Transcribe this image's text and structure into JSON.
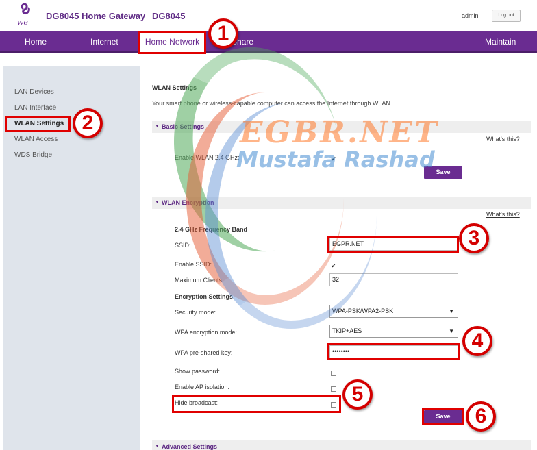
{
  "header": {
    "logo_text": "we",
    "brand": "DG8045 Home Gateway",
    "model": "DG8045",
    "user": "admin",
    "logout_label": "Log out"
  },
  "nav": {
    "items": [
      "Home",
      "Internet",
      "Home Network",
      "Share",
      "Maintain"
    ],
    "active": "Home Network"
  },
  "sidebar": {
    "items": [
      "LAN Devices",
      "LAN Interface",
      "WLAN Settings",
      "WLAN Access",
      "WDS Bridge"
    ],
    "active": "WLAN Settings"
  },
  "main": {
    "title": "WLAN Settings",
    "description": "Your smart phone or wireless-capable computer can access the Internet through WLAN.",
    "basic": {
      "header": "Basic Settings",
      "whats_this": "What's this?",
      "enable_label": "Enable WLAN 2.4 GHz:",
      "enable_checked": true,
      "save_label": "Save"
    },
    "encryption": {
      "header": "WLAN Encryption",
      "whats_this": "What's this?",
      "band_title": "2.4 GHz Frequency Band",
      "ssid_label": "SSID:",
      "ssid_value": "EGPR.NET",
      "enable_ssid_label": "Enable SSID:",
      "enable_ssid_checked": true,
      "max_clients_label": "Maximum Clients:",
      "max_clients_value": "32",
      "enc_settings_title": "Encryption Settings",
      "security_mode_label": "Security mode:",
      "security_mode_value": "WPA-PSK/WPA2-PSK",
      "wpa_mode_label": "WPA encryption mode:",
      "wpa_mode_value": "TKIP+AES",
      "psk_label": "WPA pre-shared key:",
      "psk_value": "••••••••",
      "show_password_label": "Show password:",
      "ap_isolation_label": "Enable AP isolation:",
      "hide_broadcast_label": "Hide broadcast:",
      "save_label": "Save"
    },
    "advanced": {
      "header": "Advanced Settings"
    }
  },
  "annotations": [
    "1",
    "2",
    "3",
    "4",
    "5",
    "6"
  ],
  "watermark": {
    "line1": "EGBR.NET",
    "line2": "Mustafa Rashad"
  },
  "colors": {
    "brand_purple": "#6a2c91",
    "annotation_red": "#e00000",
    "sidebar_bg": "#dfe4eb"
  }
}
